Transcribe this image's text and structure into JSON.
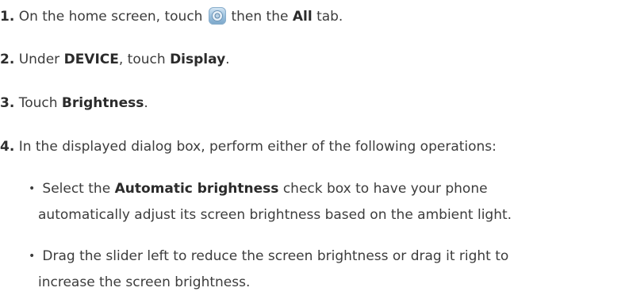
{
  "steps": [
    {
      "num": "1.",
      "pre": "On the home screen, touch",
      "icon": "settings-icon",
      "mid": "then the",
      "bold": "All",
      "post": "tab."
    },
    {
      "num": "2.",
      "pre": "Under",
      "bold1": "DEVICE",
      "mid": ", touch",
      "bold2": "Display",
      "post": "."
    },
    {
      "num": "3.",
      "pre": "Touch",
      "bold": "Brightness",
      "post": "."
    },
    {
      "num": "4.",
      "text": "In the displayed dialog box, perform either of the following operations:"
    }
  ],
  "bullets": [
    {
      "marker": "•",
      "pre": "Select the",
      "bold": "Automatic brightness",
      "post": "check box to have your phone",
      "cont": "automatically adjust its screen brightness based on the ambient light."
    },
    {
      "marker": "•",
      "line1": "Drag the slider left to reduce the screen brightness or drag it right to",
      "cont": "increase the screen brightness."
    }
  ]
}
